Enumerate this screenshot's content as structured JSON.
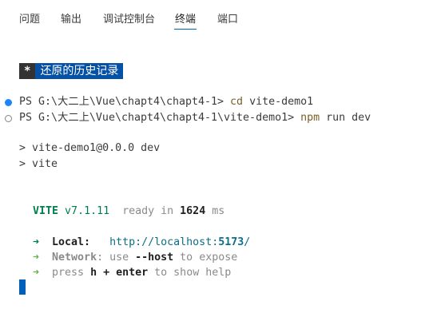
{
  "tabs": [
    {
      "label": "问题",
      "active": false
    },
    {
      "label": "输出",
      "active": false
    },
    {
      "label": "调试控制台",
      "active": false
    },
    {
      "label": "终端",
      "active": true
    },
    {
      "label": "端口",
      "active": false
    }
  ],
  "terminal": {
    "banner": {
      "star": "*",
      "text": "还原的历史记录"
    },
    "line1": {
      "prompt": "PS G:\\大二上\\Vue\\chapt4\\chapt4-1> ",
      "command": "cd",
      "args": " vite-demo1"
    },
    "line2": {
      "prompt": "PS G:\\大二上\\Vue\\chapt4\\chapt4-1\\vite-demo1> ",
      "command": "npm",
      "args": " run dev"
    },
    "line3": "> vite-demo1@0.0.0 dev",
    "line4": "> vite",
    "vite": {
      "name": "VITE",
      "version": "v7.1.11",
      "ready_prefix": "ready in ",
      "ready_time": "1624",
      "ready_unit": " ms"
    },
    "local": {
      "arrow": "➜",
      "label": "Local:",
      "url_prefix": "http://localhost:",
      "port": "5173",
      "url_suffix": "/"
    },
    "network": {
      "arrow": "➜",
      "label": "Network",
      "text1": ": use ",
      "flag": "--host",
      "text2": " to expose"
    },
    "help": {
      "arrow": "➜",
      "text1": "press ",
      "key1": "h",
      "plus": " + ",
      "key2": "enter",
      "text2": " to show help"
    }
  },
  "colors": {
    "accent": "#005fb8",
    "vite_green": "#007f4e",
    "banner_bg": "#0451a5"
  }
}
